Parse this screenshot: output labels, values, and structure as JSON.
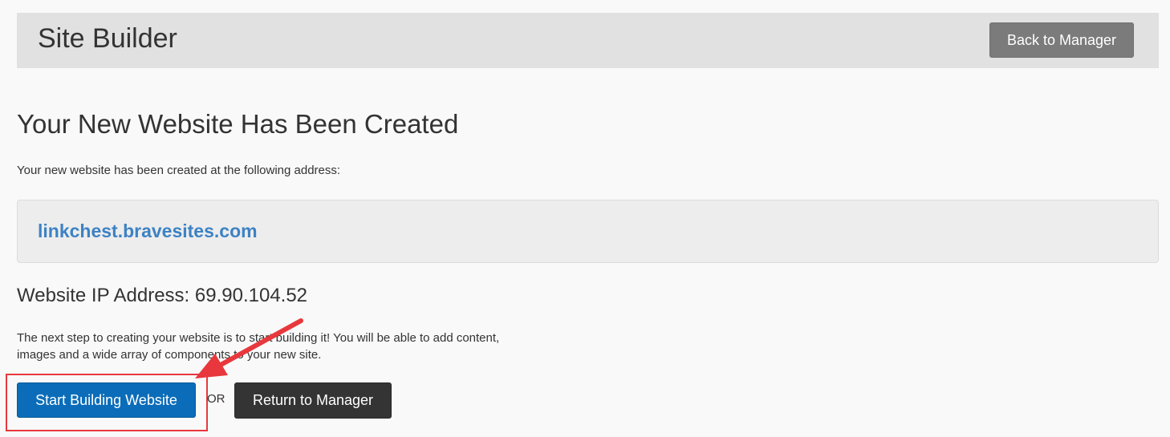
{
  "header": {
    "title": "Site Builder",
    "back_button": "Back to Manager"
  },
  "main": {
    "heading": "Your New Website Has Been Created",
    "intro": "Your new website has been created at the following address:",
    "address": "linkchest.bravesites.com",
    "ip_label": "Website IP Address: 69.90.104.52",
    "description": "The next step to creating your website is to start building it! You will be able to add content, images and a wide array of components to your new site.",
    "start_button": "Start Building Website",
    "or_text": "OR",
    "return_button": "Return to Manager"
  },
  "colors": {
    "primary": "#0b6db9",
    "link": "#3d82c4",
    "annotation": "#e8383d",
    "dark_button": "#343434"
  },
  "icons": {
    "annotation": "red-arrow-icon"
  }
}
